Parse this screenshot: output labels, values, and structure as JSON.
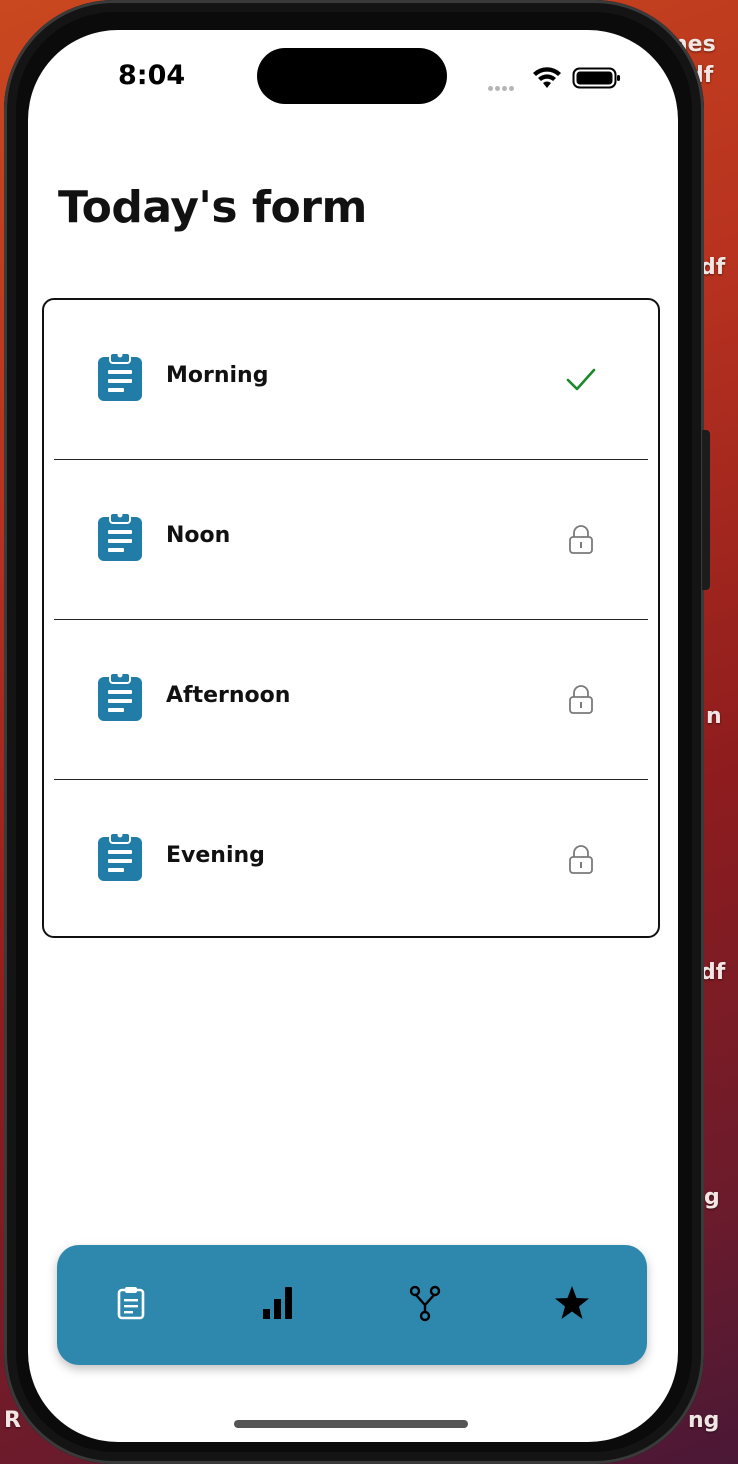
{
  "status_bar": {
    "time": "8:04"
  },
  "page": {
    "title": "Today's form"
  },
  "forms": [
    {
      "label": "Morning",
      "status": "completed",
      "status_icon": "checkmark-icon"
    },
    {
      "label": "Noon",
      "status": "locked",
      "status_icon": "lock-icon"
    },
    {
      "label": "Afternoon",
      "status": "locked",
      "status_icon": "lock-icon"
    },
    {
      "label": "Evening",
      "status": "locked",
      "status_icon": "lock-icon"
    }
  ],
  "tab_bar": {
    "tabs": [
      {
        "icon": "clipboard-icon",
        "active": true
      },
      {
        "icon": "bar-chart-icon",
        "active": false
      },
      {
        "icon": "branch-icon",
        "active": false
      },
      {
        "icon": "star-icon",
        "active": false
      }
    ]
  },
  "desktop_labels": [
    "nes",
    "df",
    "df",
    "n",
    "df",
    "g",
    "R",
    "ng"
  ],
  "colors": {
    "accent": "#2e88ad",
    "form_icon": "#217ca8",
    "check": "#1a8a2a",
    "lock": "#7a7a7a"
  }
}
